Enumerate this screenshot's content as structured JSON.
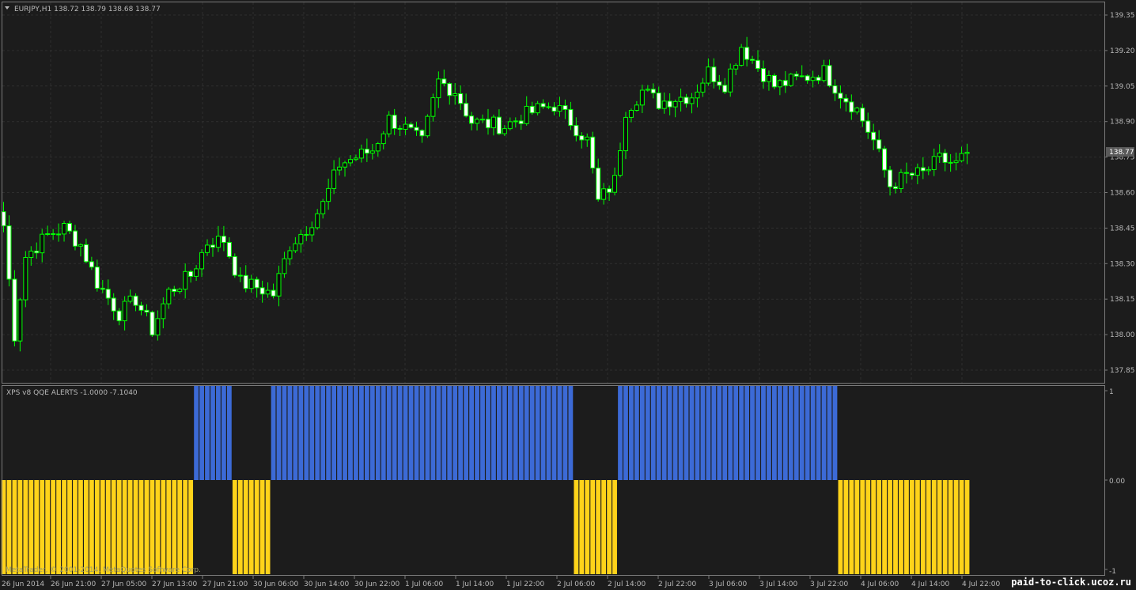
{
  "colors": {
    "background": "#1c1c1c",
    "grid": "#2e2e2e",
    "frame": "#7a7a7a",
    "axis_text": "#b8b8b8",
    "candle_outline": "#00ff00",
    "candle_bull_body": "#0c0c0c",
    "candle_bear_body": "#ffffff",
    "hist_up": "#3c6ad6",
    "hist_down": "#ffd31a",
    "price_label_bg": "#5a5a5a"
  },
  "main_chart": {
    "header_arrow_icon": "triangle-down-icon",
    "header_text": "EURJPY,H1  138.72 138.79 138.68 138.77",
    "current_price_label": "138.77"
  },
  "indicator": {
    "header_text": "XPS v8 QQE ALERTS -1.0000 -7.1040",
    "scale_labels": [
      "1",
      "0.00",
      "-1"
    ],
    "copyright": "MetaTrader, © 2001-2014, MetaQuotes Software Corp."
  },
  "watermark": "paid-to-click.ucoz.ru",
  "chart_data": [
    {
      "type": "candlestick",
      "symbol": "EURJPY",
      "timeframe": "H1",
      "ylim": [
        137.78,
        139.4
      ],
      "y_ticks": [
        "139.35",
        "139.20",
        "139.05",
        "138.90",
        "138.75",
        "138.60",
        "138.45",
        "138.30",
        "138.15",
        "138.00",
        "137.85"
      ],
      "x_labels": [
        "26 Jun 2014",
        "26 Jun 21:00",
        "27 Jun 05:00",
        "27 Jun 13:00",
        "27 Jun 21:00",
        "30 Jun 06:00",
        "30 Jun 14:00",
        "30 Jun 22:00",
        "1 Jul 06:00",
        "1 Jul 14:00",
        "1 Jul 22:00",
        "2 Jul 06:00",
        "2 Jul 14:00",
        "2 Jul 22:00",
        "3 Jul 06:00",
        "3 Jul 14:00",
        "3 Jul 22:00",
        "4 Jul 06:00",
        "4 Jul 14:00",
        "4 Jul 22:00"
      ],
      "grid": true,
      "keypoints": [
        [
          0,
          138.46
        ],
        [
          2,
          138.0
        ],
        [
          4,
          138.33
        ],
        [
          8,
          138.42
        ],
        [
          11,
          138.45
        ],
        [
          14,
          138.38
        ],
        [
          17,
          138.22
        ],
        [
          21,
          138.09
        ],
        [
          24,
          138.15
        ],
        [
          27,
          138.02
        ],
        [
          30,
          138.18
        ],
        [
          34,
          138.25
        ],
        [
          37,
          138.39
        ],
        [
          40,
          138.4
        ],
        [
          43,
          138.22
        ],
        [
          46,
          138.2
        ],
        [
          49,
          138.17
        ],
        [
          52,
          138.38
        ],
        [
          55,
          138.45
        ],
        [
          58,
          138.55
        ],
        [
          61,
          138.72
        ],
        [
          64,
          138.75
        ],
        [
          67,
          138.78
        ],
        [
          70,
          138.91
        ],
        [
          73,
          138.87
        ],
        [
          76,
          138.81
        ],
        [
          79,
          139.07
        ],
        [
          82,
          139.03
        ],
        [
          85,
          138.9
        ],
        [
          88,
          138.89
        ],
        [
          91,
          138.88
        ],
        [
          94,
          138.92
        ],
        [
          97,
          138.95
        ],
        [
          100,
          138.97
        ],
        [
          103,
          138.9
        ],
        [
          106,
          138.82
        ],
        [
          108,
          138.56
        ],
        [
          111,
          138.65
        ],
        [
          113,
          138.95
        ],
        [
          116,
          139.03
        ],
        [
          119,
          138.98
        ],
        [
          122,
          139.0
        ],
        [
          125,
          139.01
        ],
        [
          128,
          139.11
        ],
        [
          131,
          139.06
        ],
        [
          134,
          139.22
        ],
        [
          137,
          139.13
        ],
        [
          140,
          139.05
        ],
        [
          143,
          139.07
        ],
        [
          146,
          139.09
        ],
        [
          149,
          139.11
        ],
        [
          152,
          139.02
        ],
        [
          155,
          138.95
        ],
        [
          158,
          138.82
        ],
        [
          161,
          138.63
        ],
        [
          164,
          138.67
        ],
        [
          167,
          138.68
        ],
        [
          170,
          138.74
        ],
        [
          173,
          138.72
        ],
        [
          175,
          138.77
        ]
      ]
    },
    {
      "type": "bar",
      "name": "XPS v8 QQE ALERTS",
      "ylim": [
        -1,
        1
      ],
      "segments": [
        {
          "from": 0,
          "to": 34,
          "value": -1
        },
        {
          "from": 35,
          "to": 41,
          "value": 1
        },
        {
          "from": 42,
          "to": 48,
          "value": -1
        },
        {
          "from": 49,
          "to": 103,
          "value": 1
        },
        {
          "from": 104,
          "to": 111,
          "value": -1
        },
        {
          "from": 112,
          "to": 151,
          "value": 1
        },
        {
          "from": 152,
          "to": 175,
          "value": -1
        }
      ]
    }
  ]
}
